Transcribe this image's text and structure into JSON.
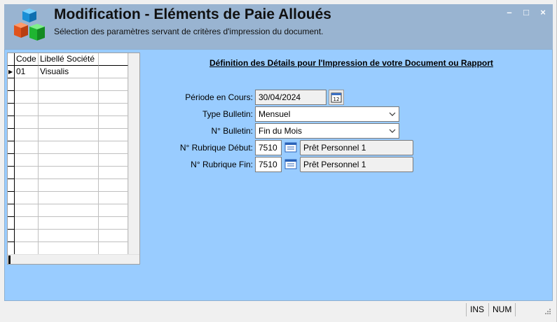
{
  "window": {
    "title": "Modification - Eléments de Paie Alloués",
    "subtitle": "Sélection des paramètres servant de critères d'impression du document.",
    "minimize": "–",
    "maximize": "□",
    "close": "×"
  },
  "grid": {
    "columns": [
      "Code",
      "Libellé Société"
    ],
    "rows": [
      {
        "code": "01",
        "label": "Visualis"
      }
    ],
    "indicator": "▶"
  },
  "form": {
    "title": "Définition des Détails pour l'Impression de votre Document ou Rapport",
    "periode": {
      "label": "Période en Cours:",
      "value": "30/04/2024"
    },
    "type_bulletin": {
      "label": "Type Bulletin:",
      "value": "Mensuel"
    },
    "num_bulletin": {
      "label": "N° Bulletin:",
      "value": "Fin du Mois"
    },
    "rubrique_debut": {
      "label": "N° Rubrique Début:",
      "code": "7510",
      "desc": "Prêt Personnel 1"
    },
    "rubrique_fin": {
      "label": "N° Rubrique Fin:",
      "code": "7510",
      "desc": "Prêt Personnel 1"
    }
  },
  "status": {
    "ins": "INS",
    "num": "NUM"
  },
  "colors": {
    "header": "#99b4d1",
    "panel": "#99ccff"
  },
  "icons": [
    "app-cubes-icon",
    "calendar-icon",
    "list-lookup-icon",
    "chevron-down-icon"
  ]
}
